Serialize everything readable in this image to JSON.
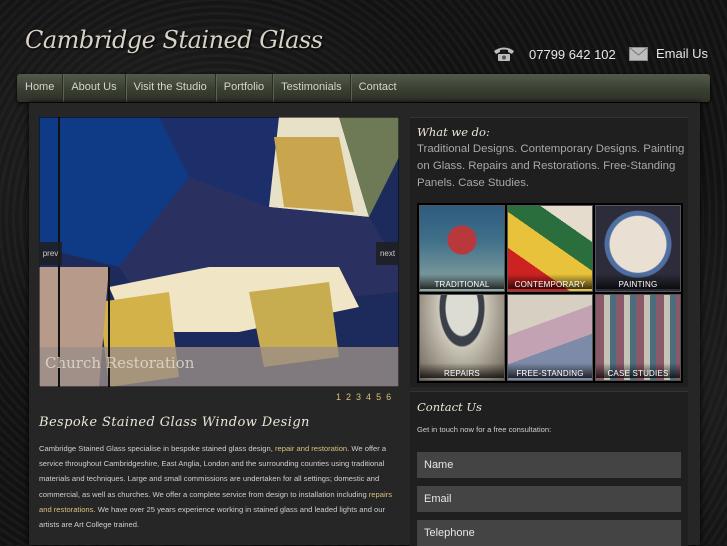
{
  "header": {
    "logo_text": "Cambridge Stained Glass",
    "phone": "07799 642 102",
    "email_label": "Email Us"
  },
  "nav": {
    "items": [
      "Home",
      "About Us",
      "Visit the Studio",
      "Portfolio",
      "Testimonials",
      "Contact"
    ]
  },
  "slider": {
    "prev_label": "prev",
    "next_label": "next",
    "caption": "Church Restoration",
    "pages": [
      "1",
      "2",
      "3",
      "4",
      "5",
      "6"
    ]
  },
  "main": {
    "title": "Bespoke Stained Glass Window Design",
    "body_part1": "Cambridge Stained Glass specialise in bespoke stained glass design, ",
    "link1": "repair and restoration",
    "body_part2": ". We offer a service throughout Cambridgeshire, East Anglia, London and the surrounding counties using traditional materials and techniques. Large and small commissions are undertaken for all settings; domestic and commercial, as well as churches. We offer a complete service from design to installation including ",
    "link2": "repairs and restorations",
    "body_part3": ". We have over 25 years experience working in stained glass and leaded lights and our artists are Art College trained."
  },
  "what_we_do": {
    "title": "What we do:",
    "text": "Traditional Designs. Contemporary Designs. Painting on Glass. Repairs and Restorations. Free-Standing Panels. Case Studies.",
    "tiles": [
      "TRADITIONAL",
      "CONTEMPORARY",
      "PAINTING",
      "REPAIRS",
      "FREE-STANDING",
      "CASE STUDIES"
    ]
  },
  "contact": {
    "title": "Contact Us",
    "intro": "Get in touch now for a free consultation:",
    "name_placeholder": "Name",
    "email_placeholder": "Email",
    "telephone_placeholder": "Telephone"
  }
}
